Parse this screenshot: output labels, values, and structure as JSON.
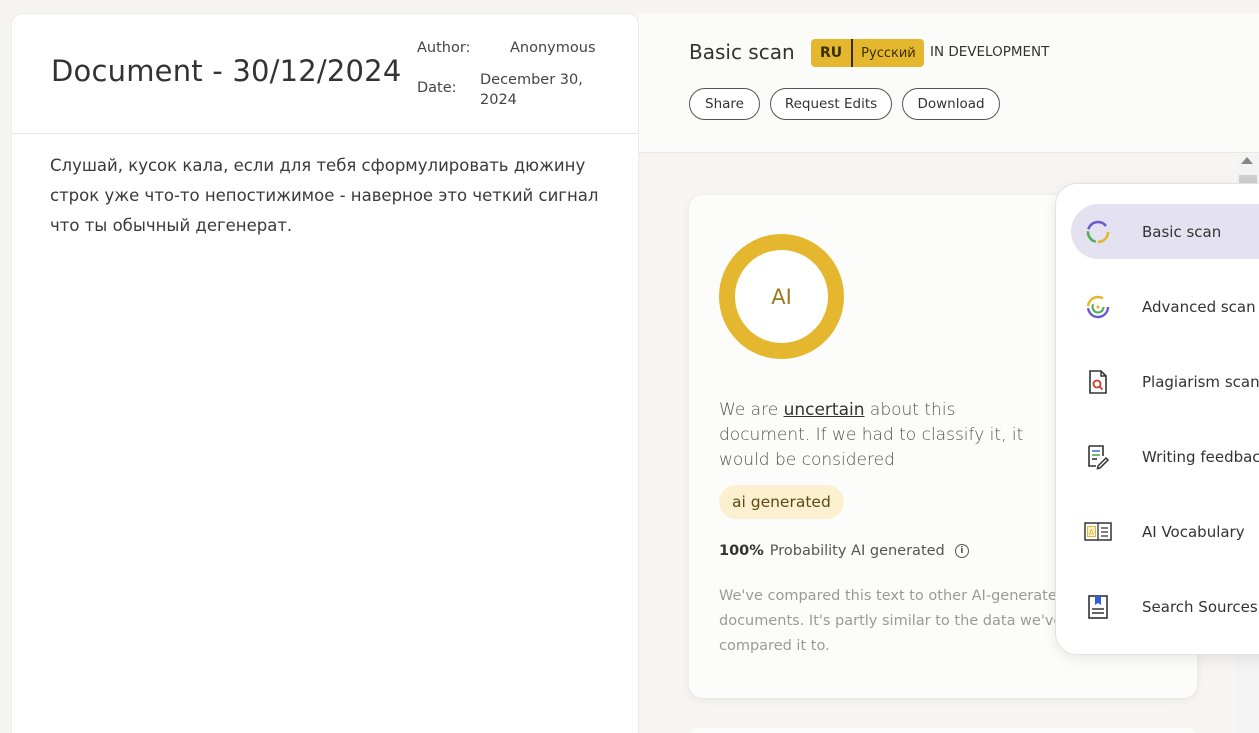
{
  "document": {
    "title": "Document - 30/12/2024",
    "author_label": "Author:",
    "author_value": "Anonymous",
    "date_label": "Date:",
    "date_value": "December 30, 2024",
    "body": "Слушай, кусок кала, если для тебя сформулировать дюжину строк уже что-то непостижимое - наверное это четкий сигнал что ты обычный дегенерат."
  },
  "topbar": {
    "scan_title": "Basic scan",
    "lang_code": "RU",
    "lang_name": "Русский",
    "status": "IN DEVELOPMENT",
    "buttons": {
      "share": "Share",
      "request_edits": "Request Edits",
      "download": "Download"
    }
  },
  "result": {
    "ring_label": "AI",
    "verdict_prefix": "We are ",
    "verdict_emph": "uncertain",
    "verdict_suffix": " about this document. If we had to classify it, it would be considered",
    "tag": "ai generated",
    "probability_value": "100%",
    "probability_text": "Probability AI generated",
    "compare_text": "We've compared this text to other AI-generated documents. It's partly similar to the data we've compared it to."
  },
  "scan_menu": {
    "items": [
      {
        "label": "Basic scan",
        "icon": "basic-scan-icon",
        "active": true
      },
      {
        "label": "Advanced scan",
        "icon": "advanced-scan-icon",
        "active": false
      },
      {
        "label": "Plagiarism scan",
        "icon": "plagiarism-icon",
        "active": false
      },
      {
        "label": "Writing feedback",
        "icon": "writing-feedback-icon",
        "active": false
      },
      {
        "label": "AI Vocabulary",
        "icon": "ai-vocabulary-icon",
        "active": false
      },
      {
        "label": "Search Sources",
        "icon": "search-sources-icon",
        "active": false
      }
    ]
  },
  "colors": {
    "accent_yellow": "#e4b72e",
    "active_menu_bg": "#e4e2f1",
    "tag_bg": "#fbf0d0"
  }
}
